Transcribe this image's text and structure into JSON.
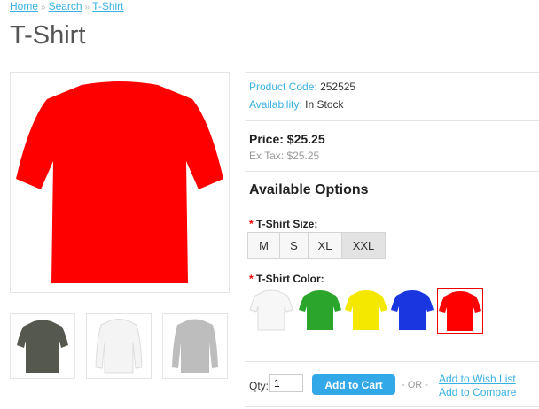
{
  "breadcrumb": {
    "home": "Home",
    "search": "Search",
    "current": "T-Shirt",
    "separator": "»"
  },
  "product": {
    "title": "T-Shirt",
    "code_label": "Product Code:",
    "code_value": "252525",
    "availability_label": "Availability:",
    "availability_value": "In Stock",
    "price": "Price: $25.25",
    "ex_tax": "Ex Tax: $25.25"
  },
  "options": {
    "heading": "Available Options",
    "size": {
      "required_mark": "*",
      "label": "T-Shirt Size:",
      "choices": [
        "M",
        "S",
        "XL",
        "XXL"
      ],
      "selected": "XXL"
    },
    "color": {
      "required_mark": "*",
      "label": "T-Shirt Color:",
      "choices": [
        "white",
        "green",
        "yellow",
        "blue",
        "red"
      ],
      "selected": "red"
    }
  },
  "cart": {
    "qty_label": "Qty:",
    "qty_value": "1",
    "add_to_cart": "Add to Cart",
    "or_text": "- OR -",
    "wishlist": "Add to Wish List",
    "compare": "Add to Compare"
  },
  "thumbnails": [
    "dark-gray-tshirt",
    "white-longsleeve",
    "gray-longsleeve"
  ],
  "colors": {
    "accent": "#38b0e3",
    "shirt_red": "#ff0000",
    "button": "#33a8e8"
  }
}
